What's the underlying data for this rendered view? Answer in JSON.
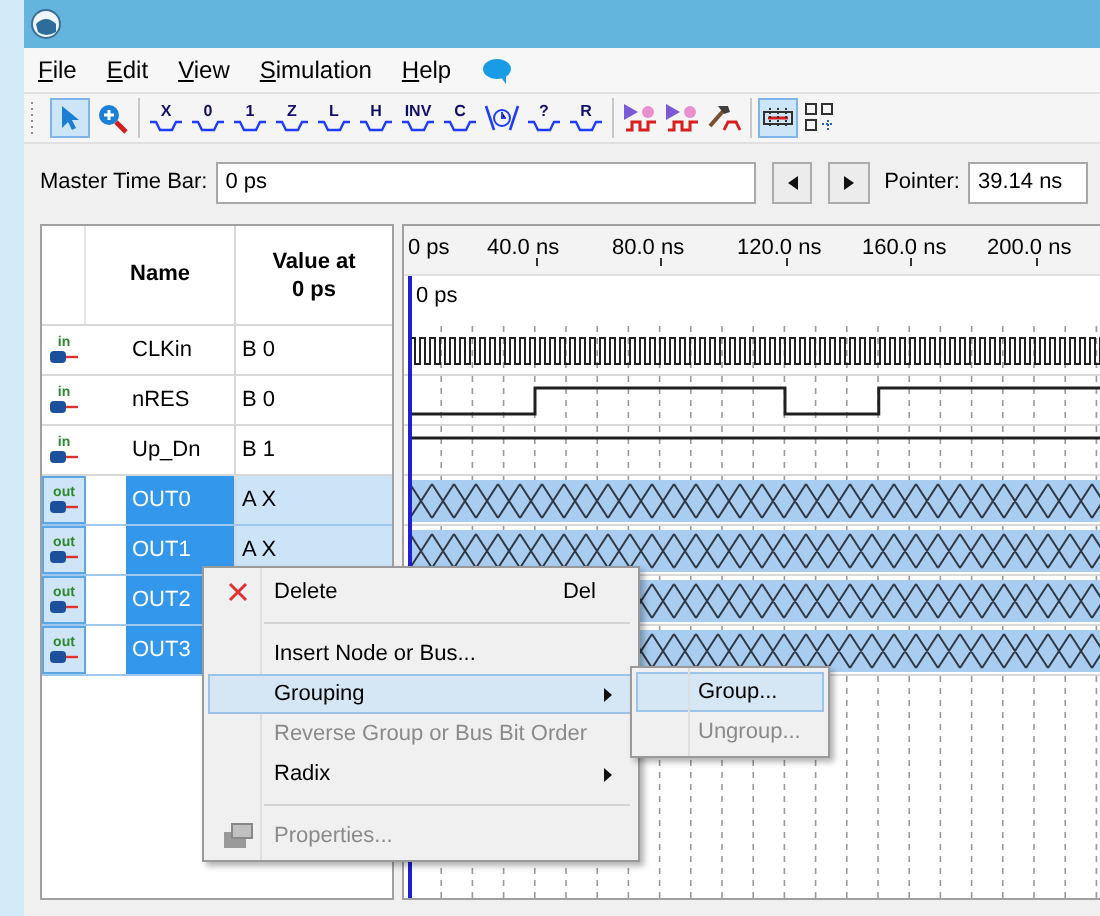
{
  "menu": [
    "File",
    "Edit",
    "View",
    "Simulation",
    "Help"
  ],
  "toolbar": [
    {
      "kind": "pointer",
      "selected": true
    },
    {
      "kind": "zoom",
      "selected": false
    },
    {
      "kind": "separator"
    },
    {
      "kind": "glyph",
      "glyph": "X",
      "selected": false
    },
    {
      "kind": "glyph",
      "glyph": "0",
      "selected": false
    },
    {
      "kind": "glyph",
      "glyph": "1",
      "selected": false
    },
    {
      "kind": "glyph",
      "glyph": "Z",
      "selected": false
    },
    {
      "kind": "glyph",
      "glyph": "L",
      "selected": false
    },
    {
      "kind": "glyph",
      "glyph": "H",
      "selected": false
    },
    {
      "kind": "glyph",
      "glyph": "INV",
      "selected": false
    },
    {
      "kind": "glyph",
      "glyph": "C",
      "selected": false
    },
    {
      "kind": "clock",
      "selected": false
    },
    {
      "kind": "glyph",
      "glyph": "?",
      "selected": false
    },
    {
      "kind": "glyph",
      "glyph": "R",
      "selected": false
    },
    {
      "kind": "separator"
    },
    {
      "kind": "run",
      "selected": false
    },
    {
      "kind": "run",
      "selected": false
    },
    {
      "kind": "hammer",
      "selected": false
    },
    {
      "kind": "separator"
    },
    {
      "kind": "snap",
      "selected": true
    },
    {
      "kind": "grid",
      "selected": false
    }
  ],
  "master_time_bar": {
    "label": "Master Time Bar:",
    "value": "0 ps"
  },
  "pointer": {
    "label": "Pointer:",
    "value": "39.14 ns"
  },
  "table": {
    "columns": [
      "Name",
      "Value at 0 ps"
    ],
    "rows": [
      {
        "direction": "in",
        "name": "CLKin",
        "value": "B 0",
        "selected": false,
        "kind": "clock"
      },
      {
        "direction": "in",
        "name": "nRES",
        "value": "B 0",
        "selected": false,
        "kind": "step"
      },
      {
        "direction": "in",
        "name": "Up_Dn",
        "value": "B 1",
        "selected": false,
        "kind": "high"
      },
      {
        "direction": "out",
        "name": "OUT0",
        "value": "A X",
        "selected": true,
        "kind": "unknown"
      },
      {
        "direction": "out",
        "name": "OUT1",
        "value": "A X",
        "selected": true,
        "kind": "unknown"
      },
      {
        "direction": "out",
        "name": "OUT2",
        "selected": true,
        "kind": "unknown"
      },
      {
        "direction": "out",
        "name": "OUT3",
        "selected": true,
        "kind": "unknown"
      }
    ]
  },
  "timeline": {
    "ticks": [
      "0 ps",
      "40.0 ns",
      "80.0 ns",
      "120.0 ns",
      "160.0 ns",
      "200.0 ns"
    ],
    "cursor_label": "0 ps"
  },
  "context_menu": [
    {
      "kind": "delete",
      "label": "Delete",
      "shortcut": "Del",
      "disabled": false,
      "selected": false,
      "submenu": false
    },
    {
      "kind": "separator"
    },
    {
      "kind": "item",
      "label": "Insert Node or Bus...",
      "disabled": false,
      "selected": false,
      "submenu": false
    },
    {
      "kind": "item",
      "label": "Grouping",
      "disabled": false,
      "selected": true,
      "submenu": true
    },
    {
      "kind": "item",
      "label": "Reverse Group or Bus Bit Order",
      "disabled": true,
      "selected": false,
      "submenu": false
    },
    {
      "kind": "item",
      "label": "Radix",
      "disabled": false,
      "selected": false,
      "submenu": true
    },
    {
      "kind": "separator"
    },
    {
      "kind": "properties",
      "label": "Properties...",
      "disabled": true,
      "selected": false,
      "submenu": false
    }
  ],
  "submenu": [
    {
      "label": "Group...",
      "disabled": false,
      "selected": true
    },
    {
      "label": "Ungroup...",
      "disabled": true,
      "selected": false
    }
  ]
}
